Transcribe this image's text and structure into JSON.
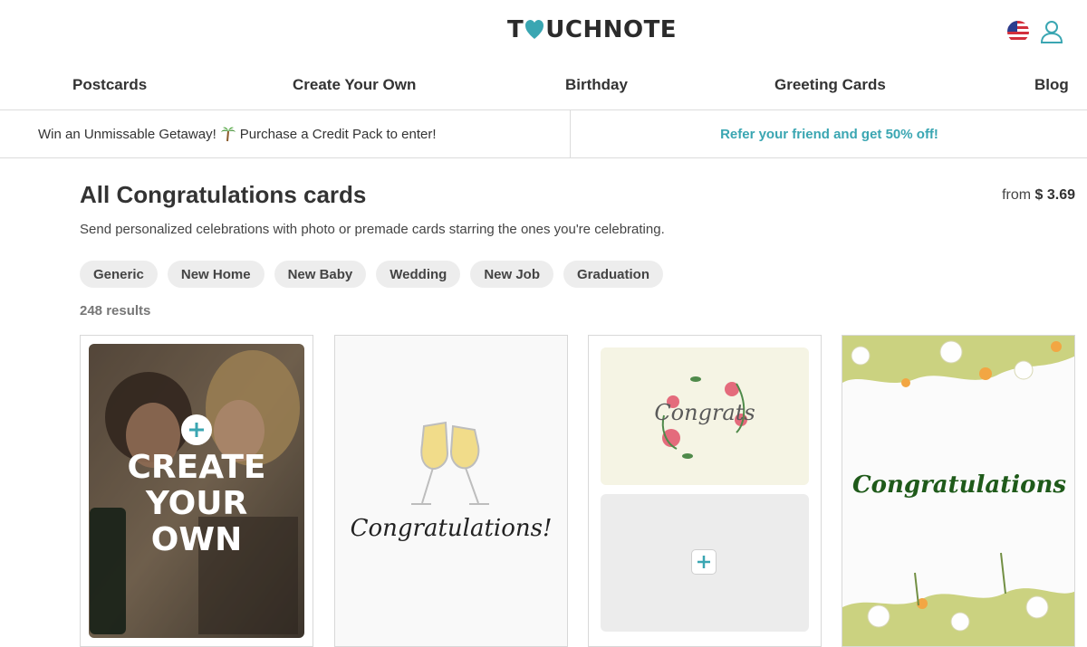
{
  "header": {
    "logo_prefix": "T",
    "logo_suffix": "UCHNOTE",
    "flag_icon": "us-flag-icon",
    "account_icon": "user-icon"
  },
  "nav": {
    "items": [
      {
        "label": "Postcards"
      },
      {
        "label": "Create Your Own"
      },
      {
        "label": "Birthday"
      },
      {
        "label": "Greeting Cards"
      },
      {
        "label": "Blog"
      }
    ]
  },
  "promo": {
    "left_text_1": "Win an Unmissable Getaway!",
    "left_text_2": "Purchase a Credit Pack to enter!",
    "right_text": "Refer your friend and get 50% off!",
    "accent": "#3aa6b2"
  },
  "page": {
    "title": "All Congratulations cards",
    "price_prefix": "from",
    "price_value": "$ 3.69",
    "subtitle": "Send personalized celebrations with photo or premade cards starring the ones you're celebrating.",
    "filters": [
      "Generic",
      "New Home",
      "New Baby",
      "Wedding",
      "New Job",
      "Graduation"
    ],
    "results": "248 results"
  },
  "cards": [
    {
      "line1": "CREATE",
      "line2": "YOUR",
      "line3": "OWN",
      "icon": "plus-icon"
    },
    {
      "text": "Congratulations!",
      "icon": "champagne-glasses-icon"
    },
    {
      "text": "Congrats",
      "icon": "plus-icon"
    },
    {
      "text": "Congratulations",
      "icon": "floral-border-icon"
    }
  ]
}
